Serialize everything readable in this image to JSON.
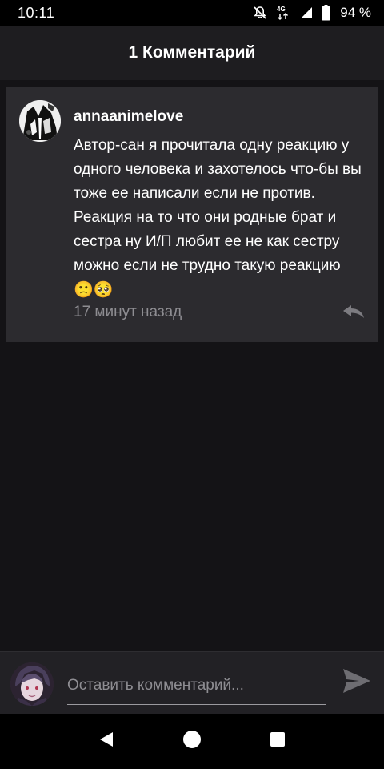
{
  "status_bar": {
    "time": "10:11",
    "network": "4G",
    "battery_text": "94 %",
    "icons": [
      "mute-icon",
      "network-4g-icon",
      "signal-icon",
      "battery-icon"
    ]
  },
  "header": {
    "title": "1 Комментарий"
  },
  "comment": {
    "author": "annaanimelove",
    "text": "Автор-сан я прочитала одну реакцию у одного человека и захотелось что-бы вы тоже ее написали если не против. Реакция на то что они родные брат и сестра ну И/П любит ее не как сестру можно если не трудно такую реакцию ",
    "emojis": "🙁🥺",
    "time_ago": "17 минут назад",
    "reply_icon": "reply-icon"
  },
  "input_bar": {
    "placeholder": "Оставить комментарий...",
    "value": "",
    "send_icon": "send-icon"
  },
  "nav": {
    "icons": [
      "back-icon",
      "home-icon",
      "recents-icon"
    ]
  },
  "colors": {
    "background": "#141316",
    "header": "#1e1d20",
    "card": "#2c2b2f",
    "muted_text": "#8e8d92"
  }
}
